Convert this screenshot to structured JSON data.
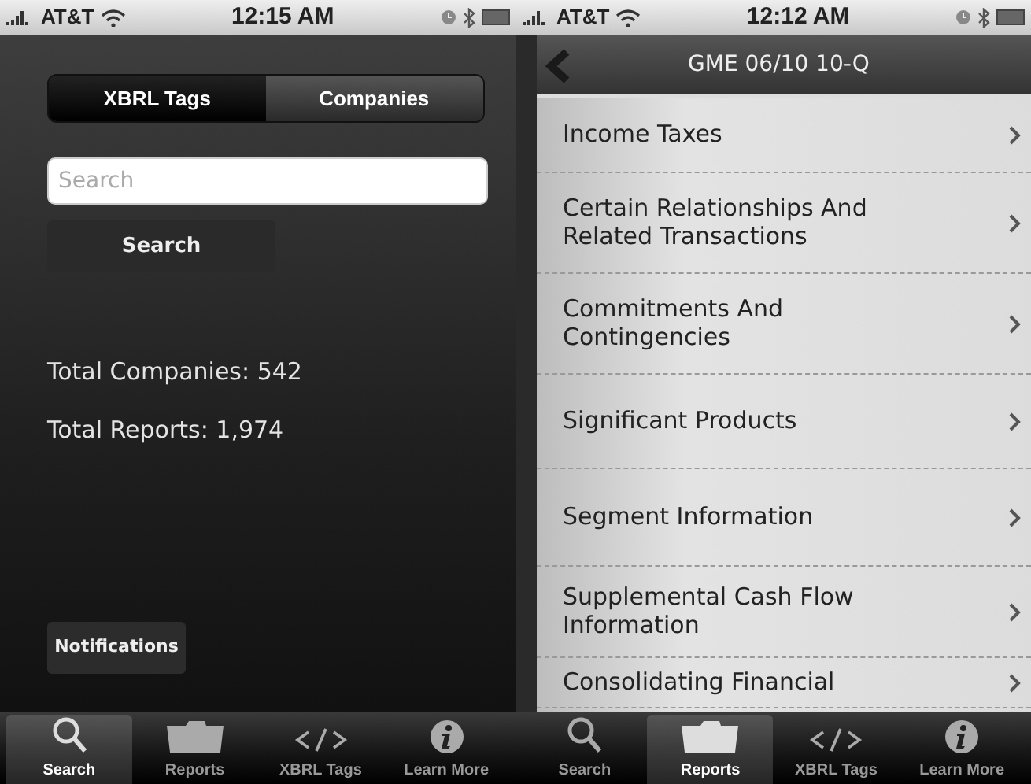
{
  "phones": [
    {
      "status_bar": {
        "carrier": "AT&T",
        "time": "12:15 AM"
      },
      "screen": {
        "kind": "search",
        "segments": [
          {
            "label": "XBRL Tags",
            "selected": true
          },
          {
            "label": "Companies",
            "selected": false
          }
        ],
        "search": {
          "placeholder": "Search"
        },
        "search_button": "Search",
        "stats": [
          "Total Companies: 542",
          "Total Reports: 1,974"
        ],
        "notifications_button": "Notifications"
      },
      "tab_bar": [
        {
          "kind": "search",
          "label": "Search",
          "selected": true
        },
        {
          "kind": "folder",
          "label": "Reports",
          "selected": false
        },
        {
          "kind": "code",
          "label": "XBRL Tags",
          "selected": false
        },
        {
          "kind": "info",
          "label": "Learn More",
          "selected": false
        }
      ]
    },
    {
      "status_bar": {
        "carrier": "AT&T",
        "time": "12:12 AM"
      },
      "screen": {
        "kind": "list",
        "title": "GME 06/10 10-Q",
        "items": [
          {
            "label": "Income Taxes"
          },
          {
            "label": "Certain Relationships And Related Transactions"
          },
          {
            "label": "Commitments And Contingencies"
          },
          {
            "label": "Significant Products"
          },
          {
            "label": "Segment Information"
          },
          {
            "label": "Supplemental Cash Flow Information"
          },
          {
            "label": "Consolidating Financial"
          }
        ]
      },
      "tab_bar": [
        {
          "kind": "search",
          "label": "Search",
          "selected": false
        },
        {
          "kind": "folder",
          "label": "Reports",
          "selected": true
        },
        {
          "kind": "code",
          "label": "XBRL Tags",
          "selected": false
        },
        {
          "kind": "info",
          "label": "Learn More",
          "selected": false
        }
      ]
    }
  ]
}
